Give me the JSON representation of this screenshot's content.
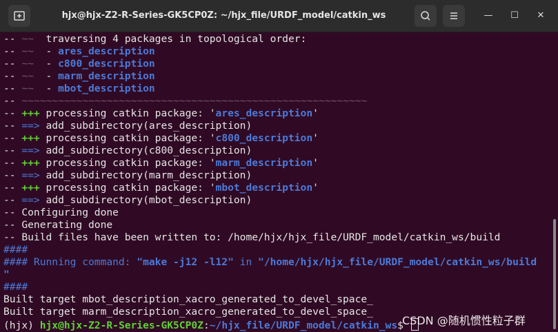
{
  "window": {
    "title": "hjx@hjx-Z2-R-Series-GK5CP0Z: ~/hjx_file/URDF_model/catkin_ws",
    "controls": {
      "minimize": "—",
      "maximize": "☐",
      "close": "✕"
    }
  },
  "icons": {
    "new_tab": "new-tab-icon",
    "search": "search-icon",
    "menu": "hamburger-menu-icon"
  },
  "colors": {
    "background": "#300a24",
    "green": "#5fd135",
    "blue": "#4b7ad9",
    "text": "#e6e6e6"
  },
  "terminal": {
    "lines": [
      [
        {
          "t": "-- "
        },
        {
          "t": "~~",
          "c": "dim"
        },
        {
          "t": "  traversing 4 packages in topological order:"
        }
      ],
      [
        {
          "t": "-- "
        },
        {
          "t": "~~",
          "c": "dim"
        },
        {
          "t": "  - "
        },
        {
          "t": "ares_description",
          "c": "bluebold"
        }
      ],
      [
        {
          "t": "-- "
        },
        {
          "t": "~~",
          "c": "dim"
        },
        {
          "t": "  - "
        },
        {
          "t": "c800_description",
          "c": "bluebold"
        }
      ],
      [
        {
          "t": "-- "
        },
        {
          "t": "~~",
          "c": "dim"
        },
        {
          "t": "  - "
        },
        {
          "t": "marm_description",
          "c": "bluebold"
        }
      ],
      [
        {
          "t": "-- "
        },
        {
          "t": "~~",
          "c": "dim"
        },
        {
          "t": "  - "
        },
        {
          "t": "mbot_description",
          "c": "bluebold"
        }
      ],
      [
        {
          "t": "-- "
        },
        {
          "t": "~~~~~~~~~~~~~~~~~~~~~~~~~~~~~~~~~~~~~~~~~~~~~~~~~~~~~~~~~",
          "c": "dim"
        }
      ],
      [
        {
          "t": "-- "
        },
        {
          "t": "+++",
          "c": "green"
        },
        {
          "t": " processing catkin package: '"
        },
        {
          "t": "ares_description",
          "c": "bluebold"
        },
        {
          "t": "'"
        }
      ],
      [
        {
          "t": "-- "
        },
        {
          "t": "==>",
          "c": "blue"
        },
        {
          "t": " add_subdirectory(ares_description)"
        }
      ],
      [
        {
          "t": "-- "
        },
        {
          "t": "+++",
          "c": "green"
        },
        {
          "t": " processing catkin package: '"
        },
        {
          "t": "c800_description",
          "c": "bluebold"
        },
        {
          "t": "'"
        }
      ],
      [
        {
          "t": "-- "
        },
        {
          "t": "==>",
          "c": "blue"
        },
        {
          "t": " add_subdirectory(c800_description)"
        }
      ],
      [
        {
          "t": "-- "
        },
        {
          "t": "+++",
          "c": "green"
        },
        {
          "t": " processing catkin package: '"
        },
        {
          "t": "marm_description",
          "c": "bluebold"
        },
        {
          "t": "'"
        }
      ],
      [
        {
          "t": "-- "
        },
        {
          "t": "==>",
          "c": "blue"
        },
        {
          "t": " add_subdirectory(marm_description)"
        }
      ],
      [
        {
          "t": "-- "
        },
        {
          "t": "+++",
          "c": "green"
        },
        {
          "t": " processing catkin package: '"
        },
        {
          "t": "mbot_description",
          "c": "bluebold"
        },
        {
          "t": "'"
        }
      ],
      [
        {
          "t": "-- "
        },
        {
          "t": "==>",
          "c": "blue"
        },
        {
          "t": " add_subdirectory(mbot_description)"
        }
      ],
      [
        {
          "t": "-- Configuring done"
        }
      ],
      [
        {
          "t": "-- Generating done"
        }
      ],
      [
        {
          "t": "-- Build files have been written to: /home/hjx/hjx_file/URDF_model/catkin_ws/build"
        }
      ],
      [
        {
          "t": "####",
          "c": "blue"
        }
      ],
      [
        {
          "t": "#### Running command: ",
          "c": "blue"
        },
        {
          "t": "\"make -j12 -l12\"",
          "c": "bluebold"
        },
        {
          "t": " in ",
          "c": "blue"
        },
        {
          "t": "\"/home/hjx/hjx_file/URDF_model/catkin_ws/build",
          "c": "bluebold"
        }
      ],
      [
        {
          "t": "\"",
          "c": "bluebold"
        }
      ],
      [
        {
          "t": "####",
          "c": "blue"
        }
      ],
      [
        {
          "t": "Built target mbot_description_xacro_generated_to_devel_space_"
        }
      ],
      [
        {
          "t": "Built target marm_description_xacro_generated_to_devel_space_"
        }
      ]
    ],
    "prompt": {
      "env": "(hjx) ",
      "user_host": "hjx@hjx-Z2-R-Series-GK5CP0Z",
      "sep": ":",
      "path": "~/hjx_file/URDF_model/catkin_ws",
      "symbol": "$ "
    }
  },
  "watermark": "CSDN @随机惯性粒子群"
}
